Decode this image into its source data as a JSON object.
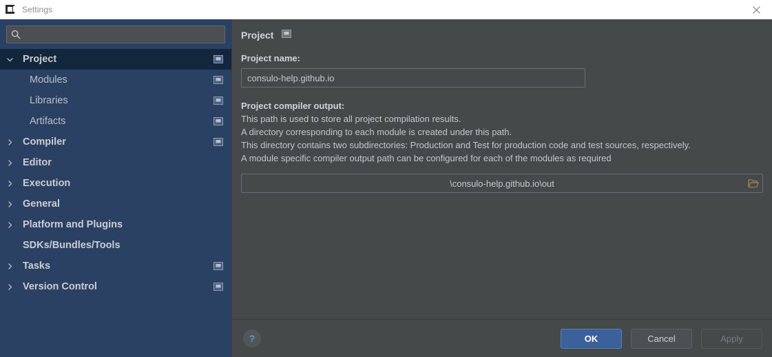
{
  "titlebar": {
    "title": "Settings",
    "app_icon": "consulo-logo-icon",
    "close_icon": "close-icon"
  },
  "sidebar": {
    "search": {
      "icon": "search-icon",
      "value": "",
      "placeholder": ""
    },
    "items": [
      {
        "label": "Project",
        "level": "top",
        "arrow": "chevron-down",
        "selected": true,
        "badge": true
      },
      {
        "label": "Modules",
        "level": "child",
        "arrow": "none",
        "selected": false,
        "badge": true
      },
      {
        "label": "Libraries",
        "level": "child",
        "arrow": "none",
        "selected": false,
        "badge": true
      },
      {
        "label": "Artifacts",
        "level": "child",
        "arrow": "none",
        "selected": false,
        "badge": true
      },
      {
        "label": "Compiler",
        "level": "top",
        "arrow": "chevron-right",
        "selected": false,
        "badge": true
      },
      {
        "label": "Editor",
        "level": "top",
        "arrow": "chevron-right",
        "selected": false,
        "badge": false
      },
      {
        "label": "Execution",
        "level": "top",
        "arrow": "chevron-right",
        "selected": false,
        "badge": false
      },
      {
        "label": "General",
        "level": "top",
        "arrow": "chevron-right",
        "selected": false,
        "badge": false
      },
      {
        "label": "Platform and Plugins",
        "level": "top",
        "arrow": "chevron-right",
        "selected": false,
        "badge": false
      },
      {
        "label": "SDKs/Bundles/Tools",
        "level": "top",
        "arrow": "none",
        "selected": false,
        "badge": false
      },
      {
        "label": "Tasks",
        "level": "top",
        "arrow": "chevron-right",
        "selected": false,
        "badge": true
      },
      {
        "label": "Version Control",
        "level": "top",
        "arrow": "chevron-right",
        "selected": false,
        "badge": true
      }
    ]
  },
  "main": {
    "header_title": "Project",
    "header_badge_icon": "project-scope-icon",
    "project_name_label": "Project name:",
    "project_name_value": "consulo-help.github.io",
    "project_name_placeholder": "",
    "compiler_output_title": "Project compiler output:",
    "compiler_output_lines": [
      "This path is used to store all project compilation results.",
      "A directory corresponding to each module is created under this path.",
      "This directory contains two subdirectories: Production and Test for production code and test sources, respectively.",
      "A module specific compiler output path can be configured for each of the modules as required"
    ],
    "output_path_value": "\\consulo-help.github.io\\out",
    "output_path_browse_icon": "folder-open-icon"
  },
  "footer": {
    "help_label": "?",
    "help_icon": "help-icon",
    "ok_label": "OK",
    "cancel_label": "Cancel",
    "apply_label": "Apply"
  },
  "colors": {
    "titlebar_bg": "#ffffff",
    "sidebar_bg": "#2b4163",
    "sidebar_selected_bg": "#12263c",
    "panel_bg": "#45494a",
    "accent_blue": "#3c6099",
    "help_blue": "#5b9bd5",
    "folder_tan": "#9a8355"
  }
}
